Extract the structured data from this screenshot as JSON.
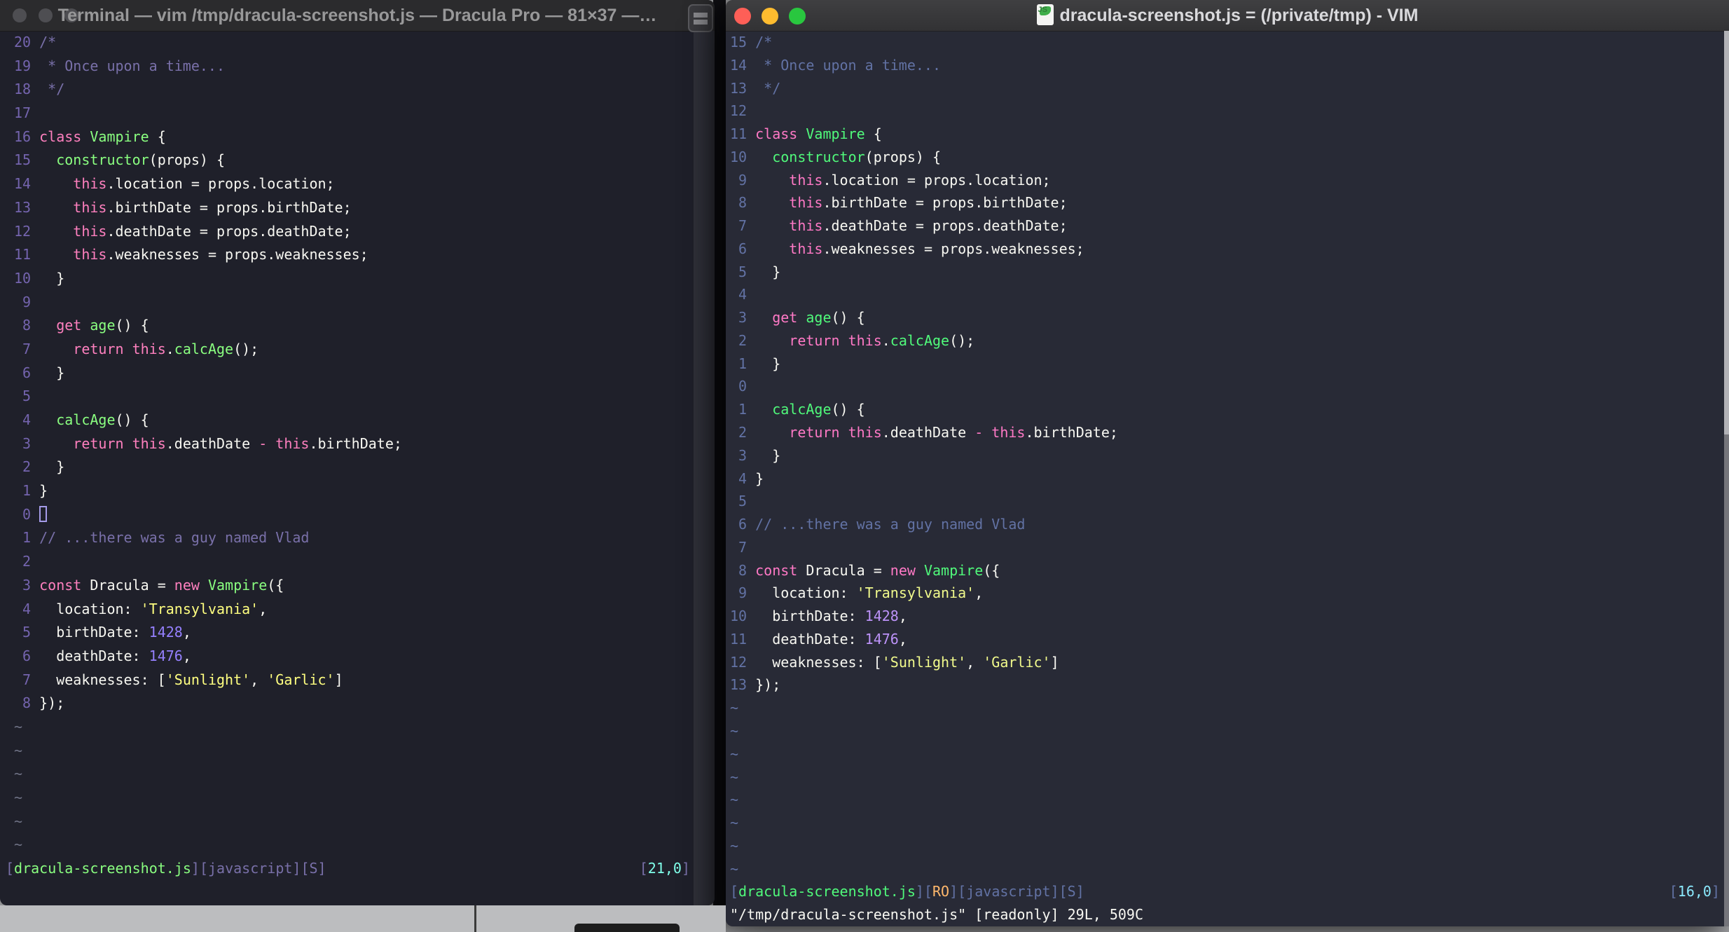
{
  "left_window": {
    "title": "Terminal — vim /tmp/dracula-screenshot.js — Dracula Pro — 81×37 —…",
    "theme_name": "Dracula Pro",
    "palette": {
      "bg": "#1F202A",
      "fg": "#F8F8F2",
      "comment": "#7970A9",
      "pink": "#FF80BF",
      "green": "#8AFF80",
      "purple": "#9580FF",
      "yellow": "#FFFF80",
      "cyan": "#80FFEA",
      "orange": "#FFCA80",
      "linenr": "#7464AE",
      "tilde": "#6F7285",
      "stat": "#7970A9"
    },
    "cursor_position": "[21,0]",
    "rows": [
      {
        "n": "20",
        "s": [
          [
            "/*",
            "comment"
          ]
        ]
      },
      {
        "n": "19",
        "s": [
          [
            " * Once upon a time...",
            "comment"
          ]
        ]
      },
      {
        "n": "18",
        "s": [
          [
            " */",
            "comment"
          ]
        ]
      },
      {
        "n": "17",
        "s": []
      },
      {
        "n": "16",
        "s": [
          [
            "class",
            "pink"
          ],
          [
            " "
          ],
          [
            "Vampire",
            "green"
          ],
          [
            " {"
          ]
        ]
      },
      {
        "n": "15",
        "s": [
          [
            "  "
          ],
          [
            "constructor",
            "green"
          ],
          [
            "(props) {"
          ]
        ]
      },
      {
        "n": "14",
        "s": [
          [
            "    "
          ],
          [
            "this",
            "pink"
          ],
          [
            ".location = props.location;"
          ]
        ]
      },
      {
        "n": "13",
        "s": [
          [
            "    "
          ],
          [
            "this",
            "pink"
          ],
          [
            ".birthDate = props.birthDate;"
          ]
        ]
      },
      {
        "n": "12",
        "s": [
          [
            "    "
          ],
          [
            "this",
            "pink"
          ],
          [
            ".deathDate = props.deathDate;"
          ]
        ]
      },
      {
        "n": "11",
        "s": [
          [
            "    "
          ],
          [
            "this",
            "pink"
          ],
          [
            ".weaknesses = props.weaknesses;"
          ]
        ]
      },
      {
        "n": "10",
        "s": [
          [
            "  }"
          ]
        ]
      },
      {
        "n": " 9",
        "s": []
      },
      {
        "n": " 8",
        "s": [
          [
            "  "
          ],
          [
            "get",
            "pink"
          ],
          [
            " "
          ],
          [
            "age",
            "green"
          ],
          [
            "() {"
          ]
        ]
      },
      {
        "n": " 7",
        "s": [
          [
            "    "
          ],
          [
            "return",
            "pink"
          ],
          [
            " "
          ],
          [
            "this",
            "pink"
          ],
          [
            "."
          ],
          [
            "calcAge",
            "green"
          ],
          [
            "();"
          ]
        ]
      },
      {
        "n": " 6",
        "s": [
          [
            "  }"
          ]
        ]
      },
      {
        "n": " 5",
        "s": []
      },
      {
        "n": " 4",
        "s": [
          [
            "  "
          ],
          [
            "calcAge",
            "green"
          ],
          [
            "() {"
          ]
        ]
      },
      {
        "n": " 3",
        "s": [
          [
            "    "
          ],
          [
            "return",
            "pink"
          ],
          [
            " "
          ],
          [
            "this",
            "pink"
          ],
          [
            ".deathDate "
          ],
          [
            "-",
            "pink"
          ],
          [
            " "
          ],
          [
            "this",
            "pink"
          ],
          [
            ".birthDate;"
          ]
        ]
      },
      {
        "n": " 2",
        "s": [
          [
            "  }"
          ]
        ]
      },
      {
        "n": " 1",
        "s": [
          [
            "}"
          ]
        ]
      },
      {
        "n": " 0",
        "s": [],
        "cursor": true
      },
      {
        "n": " 1",
        "s": [
          [
            "// ...there was a guy named Vlad",
            "comment"
          ]
        ]
      },
      {
        "n": " 2",
        "s": []
      },
      {
        "n": " 3",
        "s": [
          [
            "const",
            "pink"
          ],
          [
            " Dracula = "
          ],
          [
            "new",
            "pink"
          ],
          [
            " "
          ],
          [
            "Vampire",
            "green"
          ],
          [
            "({"
          ]
        ]
      },
      {
        "n": " 4",
        "s": [
          [
            "  location: "
          ],
          [
            "'Transylvania'",
            "yellow"
          ],
          [
            ","
          ]
        ]
      },
      {
        "n": " 5",
        "s": [
          [
            "  birthDate: "
          ],
          [
            "1428",
            "purple"
          ],
          [
            ","
          ]
        ]
      },
      {
        "n": " 6",
        "s": [
          [
            "  deathDate: "
          ],
          [
            "1476",
            "purple"
          ],
          [
            ","
          ]
        ]
      },
      {
        "n": " 7",
        "s": [
          [
            "  weaknesses: ["
          ],
          [
            "'Sunlight'",
            "yellow"
          ],
          [
            ", "
          ],
          [
            "'Garlic'",
            "yellow"
          ],
          [
            "]"
          ]
        ]
      },
      {
        "n": " 8",
        "s": [
          [
            "});"
          ]
        ]
      },
      {
        "t": "tilde",
        "s": [
          [
            "~",
            "tilde"
          ]
        ]
      },
      {
        "t": "tilde",
        "s": [
          [
            "~",
            "tilde"
          ]
        ]
      },
      {
        "t": "tilde",
        "s": [
          [
            "~",
            "tilde"
          ]
        ]
      },
      {
        "t": "tilde",
        "s": [
          [
            "~",
            "tilde"
          ]
        ]
      },
      {
        "t": "tilde",
        "s": [
          [
            "~",
            "tilde"
          ]
        ]
      },
      {
        "t": "tilde",
        "s": [
          [
            "~",
            "tilde"
          ]
        ]
      },
      {
        "t": "status",
        "s": [
          [
            "[",
            "stat"
          ],
          [
            "dracula-screenshot.js",
            "green"
          ],
          [
            "][javascript][S]",
            "stat"
          ]
        ],
        "r": [
          [
            "[",
            "stat"
          ],
          [
            "21,0",
            "cyan"
          ],
          [
            "]",
            "stat"
          ]
        ]
      },
      {
        "t": "cmd",
        "s": []
      }
    ]
  },
  "right_window": {
    "title": "dracula-screenshot.js = (/private/tmp) - VIM",
    "icon_badge": "JS",
    "palette": {
      "bg": "#282A36",
      "fg": "#F8F8F2",
      "comment": "#6272A4",
      "pink": "#FF79C6",
      "green": "#50FA7B",
      "purple": "#BD93F9",
      "yellow": "#F1FA8C",
      "cyan": "#8BE9FD",
      "orange": "#FFB86C",
      "linenr": "#6272A4",
      "tilde": "#6272A4",
      "stat": "#6272A4"
    },
    "cursor_position": "[16,0]",
    "rows": [
      {
        "n": "15",
        "s": [
          [
            "/*",
            "comment"
          ]
        ]
      },
      {
        "n": "14",
        "s": [
          [
            " * Once upon a time...",
            "comment"
          ]
        ]
      },
      {
        "n": "13",
        "s": [
          [
            " */",
            "comment"
          ]
        ]
      },
      {
        "n": "12",
        "s": []
      },
      {
        "n": "11",
        "s": [
          [
            "class",
            "pink"
          ],
          [
            " "
          ],
          [
            "Vampire",
            "green"
          ],
          [
            " {"
          ]
        ]
      },
      {
        "n": "10",
        "s": [
          [
            "  "
          ],
          [
            "constructor",
            "green"
          ],
          [
            "(props) {"
          ]
        ]
      },
      {
        "n": " 9",
        "s": [
          [
            "    "
          ],
          [
            "this",
            "pink"
          ],
          [
            ".location = props.location;"
          ]
        ]
      },
      {
        "n": " 8",
        "s": [
          [
            "    "
          ],
          [
            "this",
            "pink"
          ],
          [
            ".birthDate = props.birthDate;"
          ]
        ]
      },
      {
        "n": " 7",
        "s": [
          [
            "    "
          ],
          [
            "this",
            "pink"
          ],
          [
            ".deathDate = props.deathDate;"
          ]
        ]
      },
      {
        "n": " 6",
        "s": [
          [
            "    "
          ],
          [
            "this",
            "pink"
          ],
          [
            ".weaknesses = props.weaknesses;"
          ]
        ]
      },
      {
        "n": " 5",
        "s": [
          [
            "  }"
          ]
        ]
      },
      {
        "n": " 4",
        "s": []
      },
      {
        "n": " 3",
        "s": [
          [
            "  "
          ],
          [
            "get",
            "pink"
          ],
          [
            " "
          ],
          [
            "age",
            "green"
          ],
          [
            "() {"
          ]
        ]
      },
      {
        "n": " 2",
        "s": [
          [
            "    "
          ],
          [
            "return",
            "pink"
          ],
          [
            " "
          ],
          [
            "this",
            "pink"
          ],
          [
            "."
          ],
          [
            "calcAge",
            "green"
          ],
          [
            "();"
          ]
        ]
      },
      {
        "n": " 1",
        "s": [
          [
            "  }"
          ]
        ]
      },
      {
        "n": " 0",
        "s": []
      },
      {
        "n": " 1",
        "s": [
          [
            "  "
          ],
          [
            "calcAge",
            "green"
          ],
          [
            "() {"
          ]
        ]
      },
      {
        "n": " 2",
        "s": [
          [
            "    "
          ],
          [
            "return",
            "pink"
          ],
          [
            " "
          ],
          [
            "this",
            "pink"
          ],
          [
            ".deathDate "
          ],
          [
            "-",
            "pink"
          ],
          [
            " "
          ],
          [
            "this",
            "pink"
          ],
          [
            ".birthDate;"
          ]
        ]
      },
      {
        "n": " 3",
        "s": [
          [
            "  }"
          ]
        ]
      },
      {
        "n": " 4",
        "s": [
          [
            "}"
          ]
        ]
      },
      {
        "n": " 5",
        "s": []
      },
      {
        "n": " 6",
        "s": [
          [
            "// ...there was a guy named Vlad",
            "comment"
          ]
        ]
      },
      {
        "n": " 7",
        "s": []
      },
      {
        "n": " 8",
        "s": [
          [
            "const",
            "pink"
          ],
          [
            " Dracula = "
          ],
          [
            "new",
            "pink"
          ],
          [
            " "
          ],
          [
            "Vampire",
            "green"
          ],
          [
            "({"
          ]
        ]
      },
      {
        "n": " 9",
        "s": [
          [
            "  location: "
          ],
          [
            "'Transylvania'",
            "yellow"
          ],
          [
            ","
          ]
        ]
      },
      {
        "n": "10",
        "s": [
          [
            "  birthDate: "
          ],
          [
            "1428",
            "purple"
          ],
          [
            ","
          ]
        ]
      },
      {
        "n": "11",
        "s": [
          [
            "  deathDate: "
          ],
          [
            "1476",
            "purple"
          ],
          [
            ","
          ]
        ]
      },
      {
        "n": "12",
        "s": [
          [
            "  weaknesses: ["
          ],
          [
            "'Sunlight'",
            "yellow"
          ],
          [
            ", "
          ],
          [
            "'Garlic'",
            "yellow"
          ],
          [
            "]"
          ]
        ]
      },
      {
        "n": "13",
        "s": [
          [
            "});"
          ]
        ]
      },
      {
        "t": "tilde",
        "s": [
          [
            "~",
            "tilde"
          ]
        ]
      },
      {
        "t": "tilde",
        "s": [
          [
            "~",
            "tilde"
          ]
        ]
      },
      {
        "t": "tilde",
        "s": [
          [
            "~",
            "tilde"
          ]
        ]
      },
      {
        "t": "tilde",
        "s": [
          [
            "~",
            "tilde"
          ]
        ]
      },
      {
        "t": "tilde",
        "s": [
          [
            "~",
            "tilde"
          ]
        ]
      },
      {
        "t": "tilde",
        "s": [
          [
            "~",
            "tilde"
          ]
        ]
      },
      {
        "t": "tilde",
        "s": [
          [
            "~",
            "tilde"
          ]
        ]
      },
      {
        "t": "tilde",
        "s": [
          [
            "~",
            "tilde"
          ]
        ]
      },
      {
        "t": "status",
        "s": [
          [
            "[",
            "stat"
          ],
          [
            "dracula-screenshot.js",
            "green"
          ],
          [
            "][",
            "stat"
          ],
          [
            "RO",
            "orange"
          ],
          [
            "][javascript][S]",
            "stat"
          ]
        ],
        "r": [
          [
            "[",
            "stat"
          ],
          [
            "16,0",
            "cyan"
          ],
          [
            "]",
            "stat"
          ]
        ]
      },
      {
        "t": "cmd",
        "s": [
          [
            "\"/tmp/dracula-screenshot.js\" [readonly] 29L, 509C",
            "fg"
          ]
        ]
      }
    ]
  }
}
